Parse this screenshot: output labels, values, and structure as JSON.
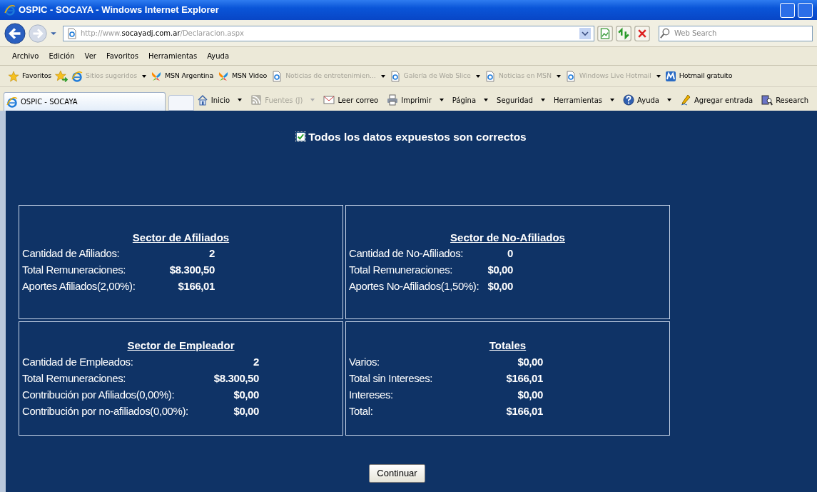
{
  "window": {
    "title": "OSPIC - SOCAYA - Windows Internet Explorer"
  },
  "address_bar": {
    "url": {
      "prefix": "http://www.",
      "domain": "socayadj.com.ar",
      "path": "/Declaracion.aspx"
    }
  },
  "search": {
    "placeholder": "Web Search"
  },
  "menu": [
    "Archivo",
    "Edición",
    "Ver",
    "Favoritos",
    "Herramientas",
    "Ayuda"
  ],
  "favorites_bar": {
    "label": "Favoritos",
    "links": [
      {
        "label": "Sitios sugeridos",
        "kind": "ie",
        "disabled": true,
        "dropdown": true
      },
      {
        "label": "MSN Argentina",
        "kind": "msn",
        "disabled": false,
        "dropdown": false
      },
      {
        "label": "MSN Video",
        "kind": "msn",
        "disabled": false,
        "dropdown": false
      },
      {
        "label": "Noticias de entretenimien...",
        "kind": "page",
        "disabled": true,
        "dropdown": true
      },
      {
        "label": "Galería de Web Slice",
        "kind": "page",
        "disabled": true,
        "dropdown": true
      },
      {
        "label": "Noticias en MSN",
        "kind": "page",
        "disabled": true,
        "dropdown": true
      },
      {
        "label": "Windows Live Hotmail",
        "kind": "page",
        "disabled": true,
        "dropdown": true
      },
      {
        "label": "Hotmail gratuito",
        "kind": "hotmail",
        "disabled": false,
        "dropdown": false
      }
    ]
  },
  "tabs": [
    {
      "title": "OSPIC - SOCAYA",
      "selected": true
    }
  ],
  "command_bar": [
    {
      "label": "Inicio",
      "kind": "home",
      "disabled": false,
      "dropdown": true
    },
    {
      "label": "Fuentes (J)",
      "kind": "feed",
      "disabled": true,
      "dropdown": true
    },
    {
      "label": "Leer correo",
      "kind": "mail",
      "disabled": false,
      "dropdown": false
    },
    {
      "label": "Imprimir",
      "kind": "print",
      "disabled": false,
      "dropdown": true
    },
    {
      "label": "Página",
      "kind": "none",
      "disabled": false,
      "dropdown": true
    },
    {
      "label": "Seguridad",
      "kind": "none",
      "disabled": false,
      "dropdown": true
    },
    {
      "label": "Herramientas",
      "kind": "none",
      "disabled": false,
      "dropdown": true
    },
    {
      "label": "Ayuda",
      "kind": "help",
      "disabled": false,
      "dropdown": true
    },
    {
      "label": "Agregar entrada",
      "kind": "blog",
      "disabled": false,
      "dropdown": false
    },
    {
      "label": "Research",
      "kind": "research",
      "disabled": false,
      "dropdown": false
    }
  ],
  "page": {
    "confirm": {
      "label": "Todos los datos expuestos son correctos",
      "checked": true
    },
    "sections": [
      {
        "title": "Sector de Afiliados",
        "rows": [
          {
            "label": "Cantidad de Afiliados:",
            "value": "2"
          },
          {
            "label": "Total Remuneraciones:",
            "value": "$8.300,50"
          },
          {
            "label": "Aportes Afiliados(2,00%):",
            "value": "$166,01"
          }
        ]
      },
      {
        "title": "Sector de No-Afiliados",
        "rows": [
          {
            "label": "Cantidad de No-Afiliados:",
            "value": "0"
          },
          {
            "label": "Total Remuneraciones:",
            "value": "$0,00"
          },
          {
            "label": "Aportes No-Afiliados(1,50%):",
            "value": "$0,00"
          }
        ]
      },
      {
        "title": "Sector de Empleador",
        "rows": [
          {
            "label": "Cantidad de Empleados:",
            "value": "2"
          },
          {
            "label": "Total Remuneraciones:",
            "value": "$8.300,50"
          },
          {
            "label": "Contribución por Afiliados(0,00%):",
            "value": "$0,00"
          },
          {
            "label": "Contribución por no-afiliados(0,00%):",
            "value": "$0,00"
          }
        ]
      },
      {
        "title": "Totales",
        "rows": [
          {
            "label": "Varios:",
            "value": "$0,00"
          },
          {
            "label": "Total sin Intereses:",
            "value": "$166,01"
          },
          {
            "label": "Intereses:",
            "value": "$0,00"
          },
          {
            "label": "Total:",
            "value": "$166,01"
          }
        ]
      }
    ],
    "button": "Continuar"
  }
}
